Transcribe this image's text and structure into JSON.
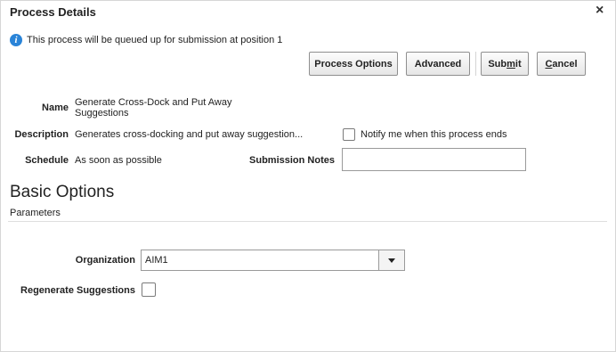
{
  "dialog": {
    "title": "Process Details",
    "close_symbol": "×"
  },
  "info": {
    "icon": "info-icon",
    "message": "This process will be queued up for submission at position 1"
  },
  "toolbar": {
    "process_options": "Process Options",
    "advanced": "Advanced",
    "submit_pre": "Sub",
    "submit_mnemonic": "m",
    "submit_post": "it",
    "cancel_mnemonic": "C",
    "cancel_post": "ancel"
  },
  "details": {
    "name_label": "Name",
    "name_value_line1": "Generate Cross-Dock and Put Away",
    "name_value_line2": "Suggestions",
    "description_label": "Description",
    "description_value": "Generates cross-docking and put away suggestion...",
    "notify_label": "Notify me when this process ends",
    "notify_checked": false,
    "schedule_label": "Schedule",
    "schedule_value": "As soon as possible",
    "submission_notes_label": "Submission Notes",
    "submission_notes_value": ""
  },
  "basic_options": {
    "heading": "Basic Options",
    "subheading": "Parameters",
    "organization_label": "Organization",
    "organization_value": "AIM1",
    "regenerate_label": "Regenerate Suggestions",
    "regenerate_checked": false
  }
}
